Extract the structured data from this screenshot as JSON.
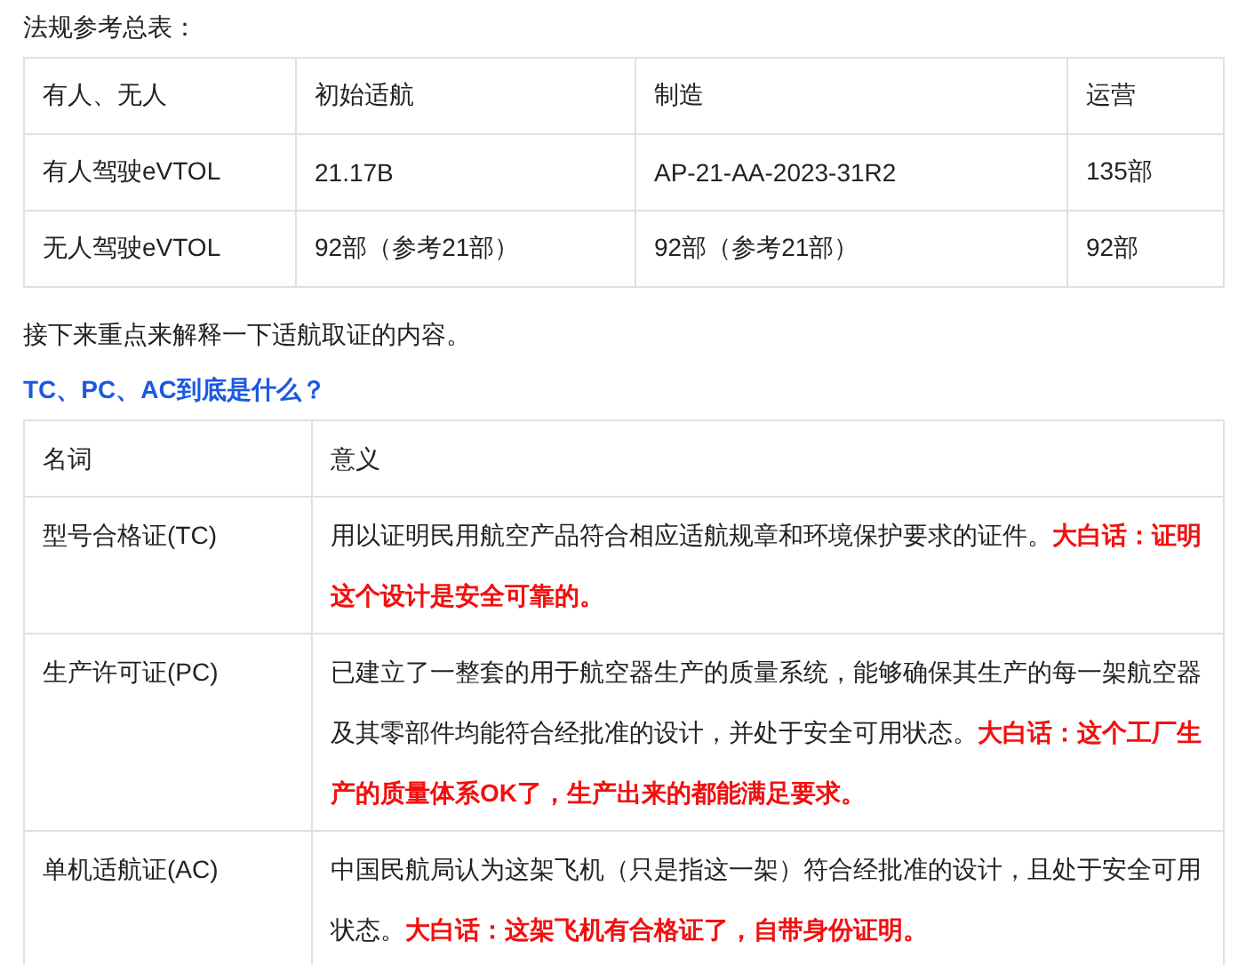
{
  "intro": "法规参考总表：",
  "regulations_table": {
    "columns": [
      "有人、无人",
      "初始适航",
      "制造",
      "运营"
    ],
    "rows": [
      [
        "有人驾驶eVTOL",
        "21.17B",
        "AP-21-AA-2023-31R2",
        "135部"
      ],
      [
        "无人驾驶eVTOL",
        "92部（参考21部）",
        "92部（参考21部）",
        "92部"
      ]
    ]
  },
  "paragraph": "接下来重点来解释一下适航取证的内容。",
  "heading": "TC、PC、AC到底是什么？",
  "terms_table": {
    "columns": [
      "名词",
      "意义"
    ],
    "rows": [
      [
        "型号合格证(TC)",
        "用以证明民用航空产品符合相应适航规章和环境保护要求的证件。**大白话：证明这个设计是安全可靠的。**"
      ],
      [
        "生产许可证(PC)",
        "已建立了一整套的用于航空器生产的质量系统，能够确保其生产的每一架航空器及其零部件均能符合经批准的设计，并处于安全可用状态。**大白话：这个工厂生产的质量体系OK了，生产出来的都能满足要求。**"
      ],
      [
        "单机适航证(AC)",
        "中国民航局认为这架飞机（只是指这一架）符合经批准的设计，且处于安全可用状态。**大白话：这架飞机有合格证了，自带身份证明。**"
      ]
    ]
  }
}
